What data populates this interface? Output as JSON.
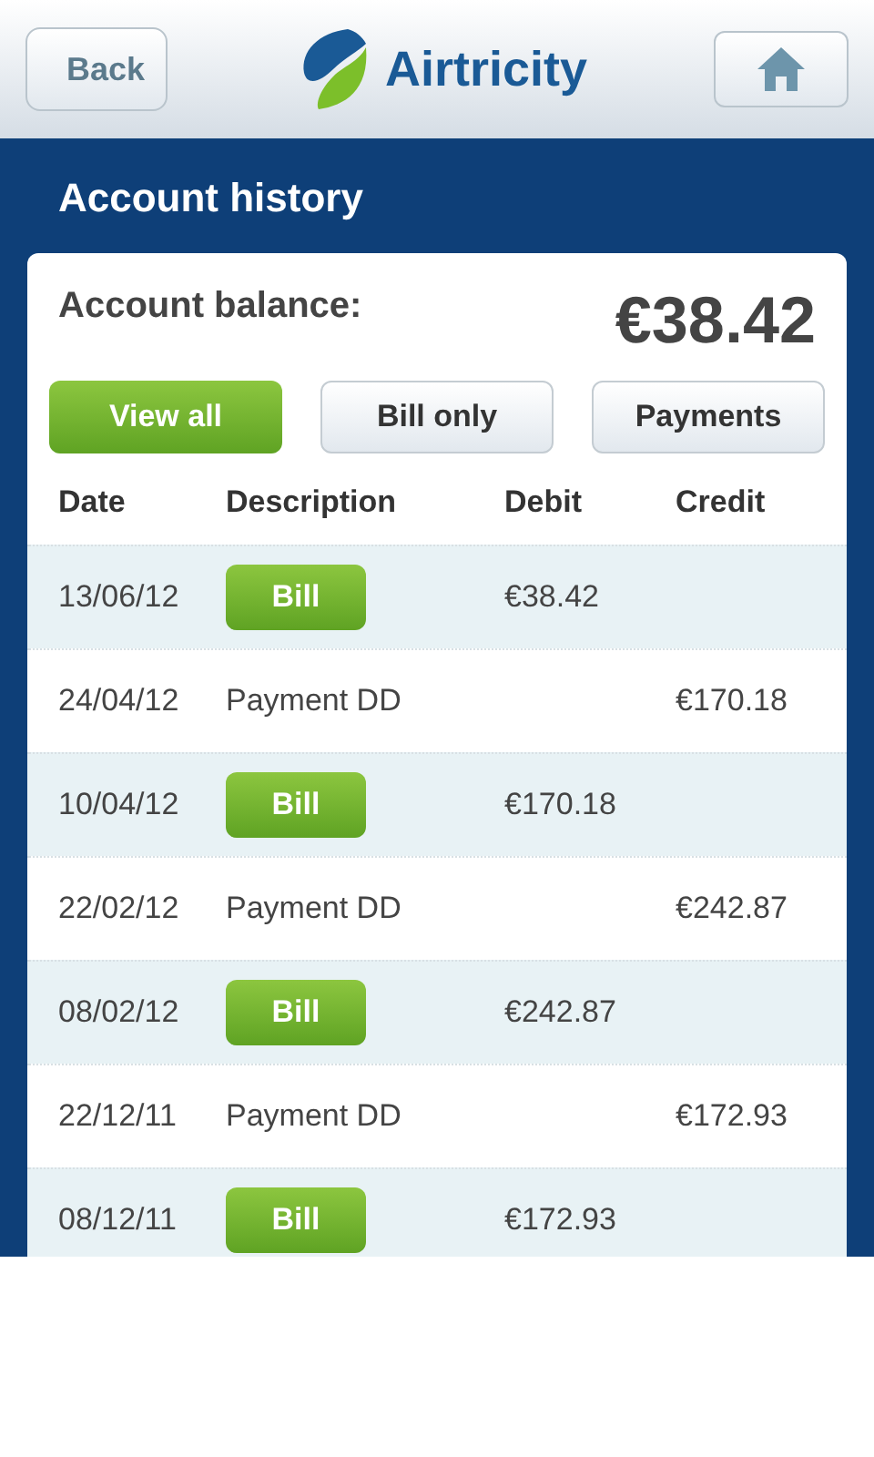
{
  "header": {
    "back": "Back",
    "logo": "Airtricity"
  },
  "title": "Account history",
  "balance": {
    "label": "Account balance:",
    "amount": "€38.42"
  },
  "filters": [
    {
      "label": "View all",
      "selected": true
    },
    {
      "label": "Bill only",
      "selected": false
    },
    {
      "label": "Payments",
      "selected": false
    }
  ],
  "table": {
    "columns": [
      "Date",
      "Description",
      "Debit",
      "Credit"
    ],
    "rows": [
      {
        "kind": "bill",
        "date": "13/06/12",
        "description": "Bill",
        "debit": "€38.42"
      },
      {
        "kind": "payment",
        "date": "24/04/12",
        "description": "Payment DD",
        "credit": "€170.18"
      },
      {
        "kind": "bill",
        "date": "10/04/12",
        "description": "Bill",
        "debit": "€170.18"
      },
      {
        "kind": "payment",
        "date": "22/02/12",
        "description": "Payment DD",
        "credit": "€242.87"
      },
      {
        "kind": "bill",
        "date": "08/02/12",
        "description": "Bill",
        "debit": "€242.87"
      },
      {
        "kind": "payment",
        "date": "22/12/11",
        "description": "Payment DD",
        "credit": "€172.93"
      },
      {
        "kind": "bill",
        "date": "08/12/11",
        "description": "Bill",
        "debit": "€172.93"
      }
    ]
  }
}
